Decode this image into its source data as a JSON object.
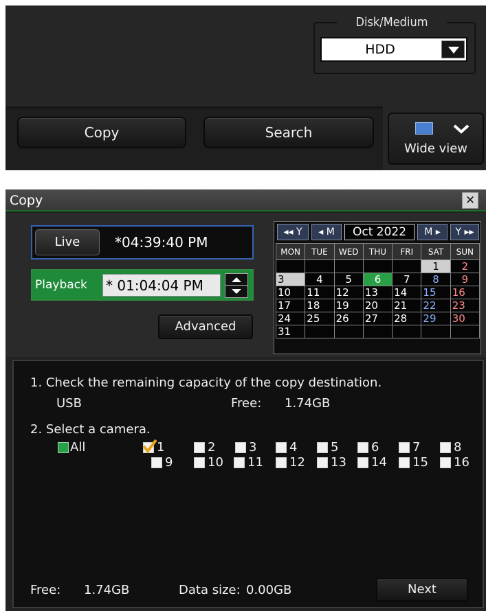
{
  "top_panel": {
    "disk_medium_label": "Disk/Medium",
    "disk_medium_value": "HDD",
    "copy_button": "Copy",
    "search_button": "Search",
    "wide_view_label": "Wide view"
  },
  "copy_window": {
    "title": "Copy",
    "close_symbol": "✕",
    "live_button": "Live",
    "live_time": "*04:39:40 PM",
    "playback_label": "Playback",
    "playback_time": "* 01:04:04 PM",
    "advanced_button": "Advanced",
    "calendar": {
      "nav_prev_year": "◂◂ Y",
      "nav_prev_month": "◂ M",
      "month_label": "Oct 2022",
      "nav_next_month": "M ▸",
      "nav_next_year": "Y ▸▸",
      "weekdays": [
        "MON",
        "TUE",
        "WED",
        "THU",
        "FRI",
        "SAT",
        "SUN"
      ],
      "weeks": [
        [
          "",
          "",
          "",
          "",
          "",
          "1",
          "2"
        ],
        [
          "3",
          "4",
          "5",
          "6",
          "7",
          "8",
          "9"
        ],
        [
          "10",
          "11",
          "12",
          "13",
          "14",
          "15",
          "16"
        ],
        [
          "17",
          "18",
          "19",
          "20",
          "21",
          "22",
          "23"
        ],
        [
          "24",
          "25",
          "26",
          "27",
          "28",
          "29",
          "30"
        ],
        [
          "31",
          "",
          "",
          "",
          "",
          "",
          ""
        ]
      ],
      "selected_day": "3",
      "today": "6"
    },
    "step1": "1. Check the remaining capacity of the copy destination.",
    "destination_label": "USB",
    "destination_free_label": "Free:",
    "destination_free_value": "1.74GB",
    "step2": "2. Select a camera.",
    "all_label": "All",
    "cameras": [
      {
        "label": "1",
        "checked": true
      },
      {
        "label": "2",
        "checked": false
      },
      {
        "label": "3",
        "checked": false
      },
      {
        "label": "4",
        "checked": false
      },
      {
        "label": "5",
        "checked": false
      },
      {
        "label": "6",
        "checked": false
      },
      {
        "label": "7",
        "checked": false
      },
      {
        "label": "8",
        "checked": false
      },
      {
        "label": "9",
        "checked": false
      },
      {
        "label": "10",
        "checked": false
      },
      {
        "label": "11",
        "checked": false
      },
      {
        "label": "12",
        "checked": false
      },
      {
        "label": "13",
        "checked": false
      },
      {
        "label": "14",
        "checked": false
      },
      {
        "label": "15",
        "checked": false
      },
      {
        "label": "16",
        "checked": false
      }
    ],
    "footer_free_label": "Free:",
    "footer_free_value": "1.74GB",
    "data_size_label": "Data size:",
    "data_size_value": "0.00GB",
    "next_button": "Next"
  },
  "colors": {
    "live_border": "#3562b0",
    "playback_green": "#1f8a3a",
    "today_green": "#2aa046",
    "check_orange": "#e8a317"
  },
  "icons": {
    "disk_dropdown": "triangle-down-icon",
    "wide_view": "screen-rect-icon",
    "wide_view_chevron": "chevron-down-icon",
    "checkbox_check": "check-mark-icon"
  }
}
